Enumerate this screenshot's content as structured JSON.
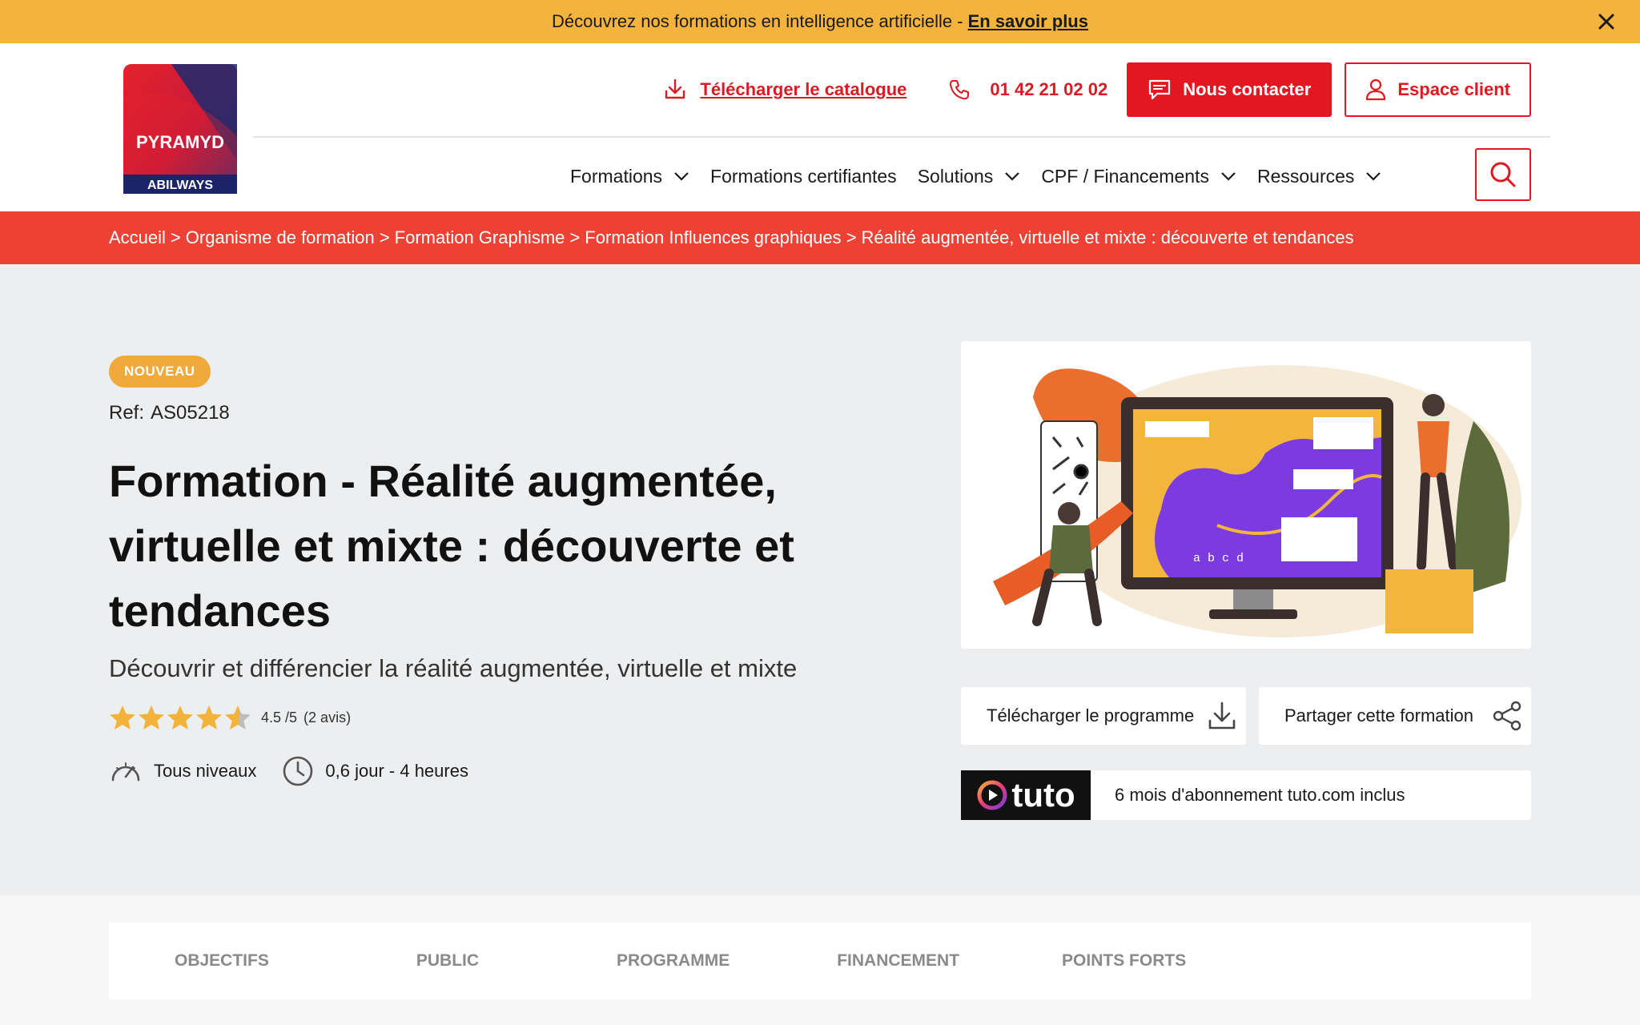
{
  "promo": {
    "text": "Découvrez nos formations en intelligence artificielle -",
    "link": "En savoir plus"
  },
  "logo": {
    "line1": "PYRAMYD",
    "line2": "ABILWAYS"
  },
  "utility": {
    "catalog": "Télécharger le catalogue",
    "phone": "01 42 21 02 02",
    "contact": "Nous contacter",
    "client": "Espace client"
  },
  "nav": [
    {
      "label": "Formations",
      "dropdown": true
    },
    {
      "label": "Formations certifiantes",
      "dropdown": false
    },
    {
      "label": "Solutions",
      "dropdown": true
    },
    {
      "label": "CPF / Financements",
      "dropdown": true
    },
    {
      "label": "Ressources",
      "dropdown": true
    }
  ],
  "breadcrumb": [
    "Accueil",
    "Organisme de formation",
    "Formation Graphisme",
    "Formation Influences graphiques",
    "Réalité augmentée, virtuelle et mixte : découverte et tendances"
  ],
  "course": {
    "badge": "NOUVEAU",
    "ref_label": "Ref:",
    "ref_value": "AS05218",
    "title": "Formation - Réalité augmentée, virtuelle et mixte : découverte et tendances",
    "subtitle": "Découvrir et différencier la réalité augmentée, virtuelle et mixte",
    "rating_value": 4.5,
    "rating_text": "4.5 /5",
    "reviews": "(2 avis)",
    "level": "Tous niveaux",
    "duration": "0,6 jour - 4 heures"
  },
  "actions": {
    "download": "Télécharger le programme",
    "share": "Partager cette formation"
  },
  "tuto": {
    "logo_text": "tuto",
    "text": "6 mois d'abonnement tuto.com inclus"
  },
  "tabs": [
    "OBJECTIFS",
    "PUBLIC",
    "PROGRAMME",
    "FINANCEMENT",
    "POINTS FORTS"
  ],
  "illustration": {
    "label": "a b c d"
  },
  "colors": {
    "promo": "#f4b33c",
    "brand_red": "#e3171f",
    "breadcrumb": "#ed4136",
    "badge": "#f0a93b",
    "star": "#f3b338"
  }
}
